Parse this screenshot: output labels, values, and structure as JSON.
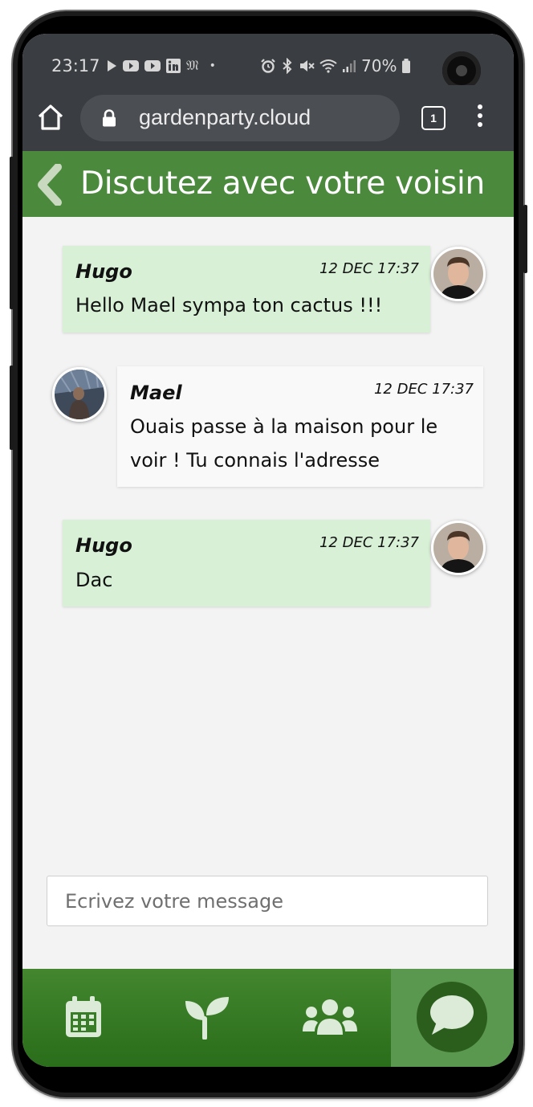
{
  "status_bar": {
    "time": "23:17",
    "battery": "70%",
    "left_icons": [
      "play-icon",
      "youtube-icon",
      "youtube-icon",
      "linkedin-icon",
      "news-icon",
      "dot-icon"
    ],
    "right_icons": [
      "alarm-icon",
      "bluetooth-icon",
      "mute-icon",
      "wifi-icon",
      "signal-icon",
      "battery-icon"
    ]
  },
  "browser": {
    "url": "gardenparty.cloud",
    "tab_count": "1"
  },
  "header": {
    "title": "Discutez avec votre voisin"
  },
  "messages": [
    {
      "author": "Hugo",
      "date": "12 DEC 17:37",
      "text": "Hello Mael sympa ton cactus !!!",
      "side": "mine"
    },
    {
      "author": "Mael",
      "date": "12 DEC 17:37",
      "text": "Ouais passe à la maison pour le voir ! Tu connais l'adresse",
      "side": "theirs"
    },
    {
      "author": "Hugo",
      "date": "12 DEC 17:37",
      "text": "Dac",
      "side": "mine"
    }
  ],
  "composer": {
    "placeholder": "Ecrivez votre message",
    "value": ""
  },
  "bottom_nav": [
    {
      "icon": "calendar-icon",
      "active": false
    },
    {
      "icon": "sprout-icon",
      "active": false
    },
    {
      "icon": "users-icon",
      "active": false
    },
    {
      "icon": "chat-icon",
      "active": true
    }
  ],
  "colors": {
    "app_bar": "#4b8a3c",
    "nav_bar": "#3a7d28",
    "nav_active": "#5a9850",
    "bubble_mine": "#d8f0d6",
    "bubble_theirs": "#f9f9f9",
    "browser_chrome": "#3a3d41"
  }
}
